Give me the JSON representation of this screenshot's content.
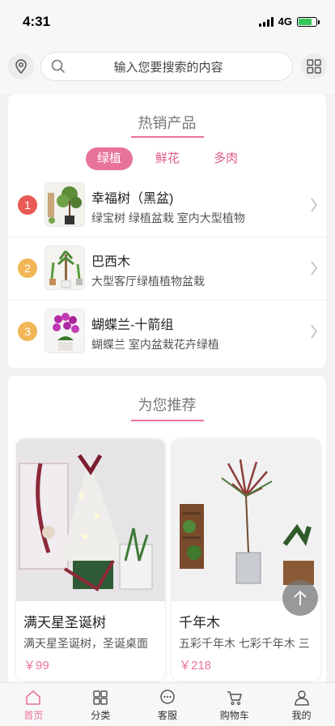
{
  "status_bar": {
    "time": "4:31",
    "network": "4G"
  },
  "search": {
    "placeholder": "输入您要搜索的内容"
  },
  "hot": {
    "title": "热销产品",
    "tabs": [
      {
        "label": "绿植"
      },
      {
        "label": "鲜花"
      },
      {
        "label": "多肉"
      }
    ],
    "items": [
      {
        "rank": "1",
        "name": "幸福树（黑盆)",
        "desc": "绿宝树 绿植盆栽 室内大型植物"
      },
      {
        "rank": "2",
        "name": "巴西木",
        "desc": "大型客厅绿植植物盆栽"
      },
      {
        "rank": "3",
        "name": "蝴蝶兰-十箭组",
        "desc": "蝴蝶兰 室内盆栽花卉绿植"
      }
    ]
  },
  "recommend": {
    "title": "为您推荐",
    "items": [
      {
        "name": "满天星圣诞树",
        "desc": "满天星圣诞树，圣诞桌面",
        "price": "￥99"
      },
      {
        "name": "千年木",
        "desc": "五彩千年木 七彩千年木 三",
        "price": "￥218"
      }
    ]
  },
  "tab_bar": [
    {
      "label": "首页"
    },
    {
      "label": "分类"
    },
    {
      "label": "客服"
    },
    {
      "label": "购物车"
    },
    {
      "label": "我的"
    }
  ],
  "colors": {
    "accent": "#e8739a",
    "rank1": "#e95a55",
    "rank2": "#f2b657",
    "rank3": "#f2b657"
  }
}
